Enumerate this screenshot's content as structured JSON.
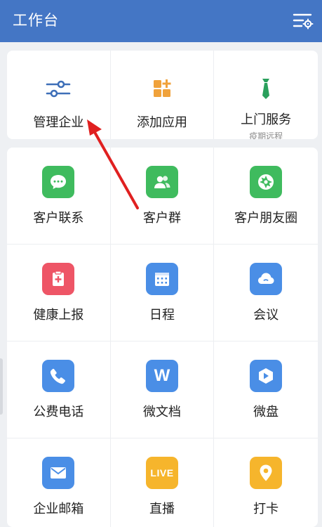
{
  "header": {
    "title": "工作台",
    "settings_icon": "settings-list-icon",
    "bg_color": "#4476c5"
  },
  "top_actions": [
    {
      "label": "管理企业",
      "icon": "sliders-icon",
      "color": "#3e6fb8"
    },
    {
      "label": "添加应用",
      "icon": "add-app-icon",
      "color": "#f0a23b"
    },
    {
      "label": "上门服务",
      "sub": "疫期远程",
      "icon": "tie-icon",
      "color": "#2aa05c"
    }
  ],
  "apps": [
    {
      "label": "客户联系",
      "icon": "chat-bubble-icon",
      "color": "#3fbb5e"
    },
    {
      "label": "客户群",
      "icon": "group-icon",
      "color": "#3fbb5e"
    },
    {
      "label": "客户朋友圈",
      "icon": "aperture-icon",
      "color": "#3fbb5e"
    },
    {
      "label": "健康上报",
      "icon": "clipboard-plus-icon",
      "color": "#ee5566"
    },
    {
      "label": "日程",
      "icon": "calendar-icon",
      "color": "#4a8ee6"
    },
    {
      "label": "会议",
      "icon": "cloud-icon",
      "color": "#4a8ee6"
    },
    {
      "label": "公费电话",
      "icon": "phone-icon",
      "color": "#4a8ee6"
    },
    {
      "label": "微文档",
      "icon": "doc-w-icon",
      "color": "#4a8ee6",
      "glyph": "W"
    },
    {
      "label": "微盘",
      "icon": "drive-icon",
      "color": "#4a8ee6"
    },
    {
      "label": "企业邮箱",
      "icon": "mail-icon",
      "color": "#4a8ee6"
    },
    {
      "label": "直播",
      "icon": "live-icon",
      "color": "#f6b52c",
      "glyph": "LIVE"
    },
    {
      "label": "打卡",
      "icon": "location-pin-icon",
      "color": "#f6b52c"
    }
  ],
  "annotation": {
    "color": "#e02020"
  }
}
